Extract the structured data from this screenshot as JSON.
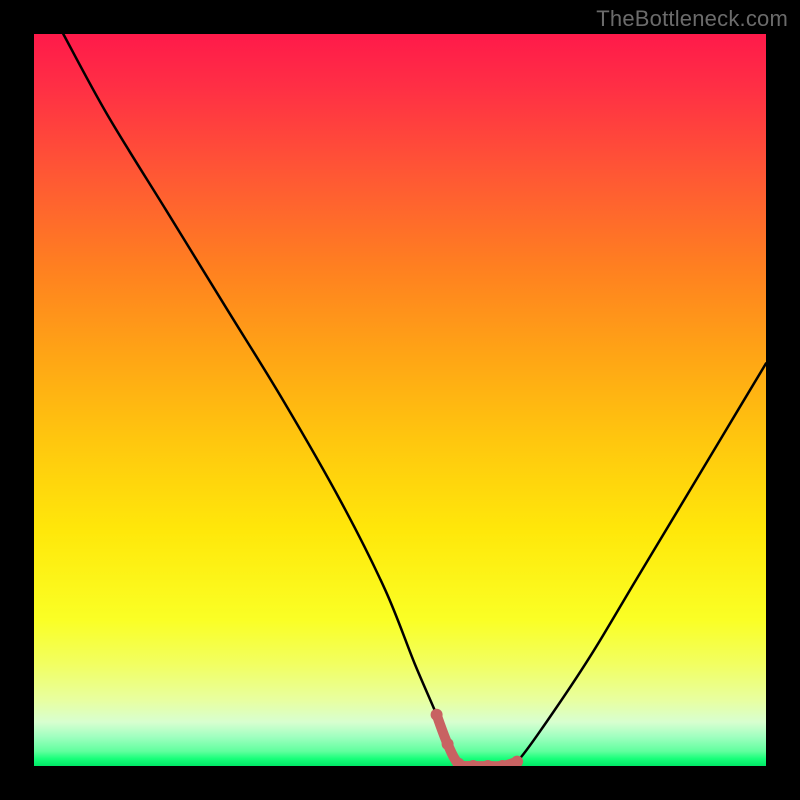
{
  "watermark": "TheBottleneck.com",
  "chart_data": {
    "type": "line",
    "title": "",
    "xlabel": "",
    "ylabel": "",
    "xlim": [
      0,
      100
    ],
    "ylim": [
      0,
      100
    ],
    "series": [
      {
        "name": "bottleneck-curve",
        "x": [
          4,
          10,
          18,
          26,
          34,
          42,
          48,
          52,
          55,
          56.5,
          58,
          60,
          62,
          64,
          66,
          70,
          76,
          82,
          88,
          94,
          100
        ],
        "values": [
          100,
          89,
          76,
          63,
          50,
          36,
          24,
          14,
          7,
          3,
          0.3,
          0,
          0,
          0,
          0.6,
          6,
          15,
          25,
          35,
          45,
          55
        ]
      }
    ],
    "lowlight_range": {
      "x_start": 55,
      "x_end": 66
    },
    "colors": {
      "curve": "#000000",
      "lowlight": "#c86262",
      "lowlight_dot": "#c86262"
    }
  }
}
